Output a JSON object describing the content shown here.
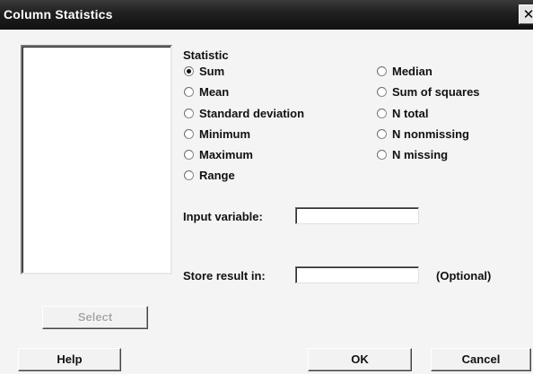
{
  "window": {
    "title": "Column Statistics",
    "close_glyph": "✕"
  },
  "statistic": {
    "group_label": "Statistic",
    "options_left": [
      {
        "label": "Sum",
        "checked": true
      },
      {
        "label": "Mean",
        "checked": false
      },
      {
        "label": "Standard deviation",
        "checked": false
      },
      {
        "label": "Minimum",
        "checked": false
      },
      {
        "label": "Maximum",
        "checked": false
      },
      {
        "label": "Range",
        "checked": false
      }
    ],
    "options_right": [
      {
        "label": "Median",
        "checked": false
      },
      {
        "label": "Sum of squares",
        "checked": false
      },
      {
        "label": "N total",
        "checked": false
      },
      {
        "label": "N nonmissing",
        "checked": false
      },
      {
        "label": "N missing",
        "checked": false
      }
    ]
  },
  "input_variable": {
    "label": "Input variable:",
    "value": ""
  },
  "store_result": {
    "label": "Store result in:",
    "value": "",
    "optional_note": "(Optional)"
  },
  "buttons": {
    "select": "Select",
    "help": "Help",
    "ok": "OK",
    "cancel": "Cancel"
  }
}
